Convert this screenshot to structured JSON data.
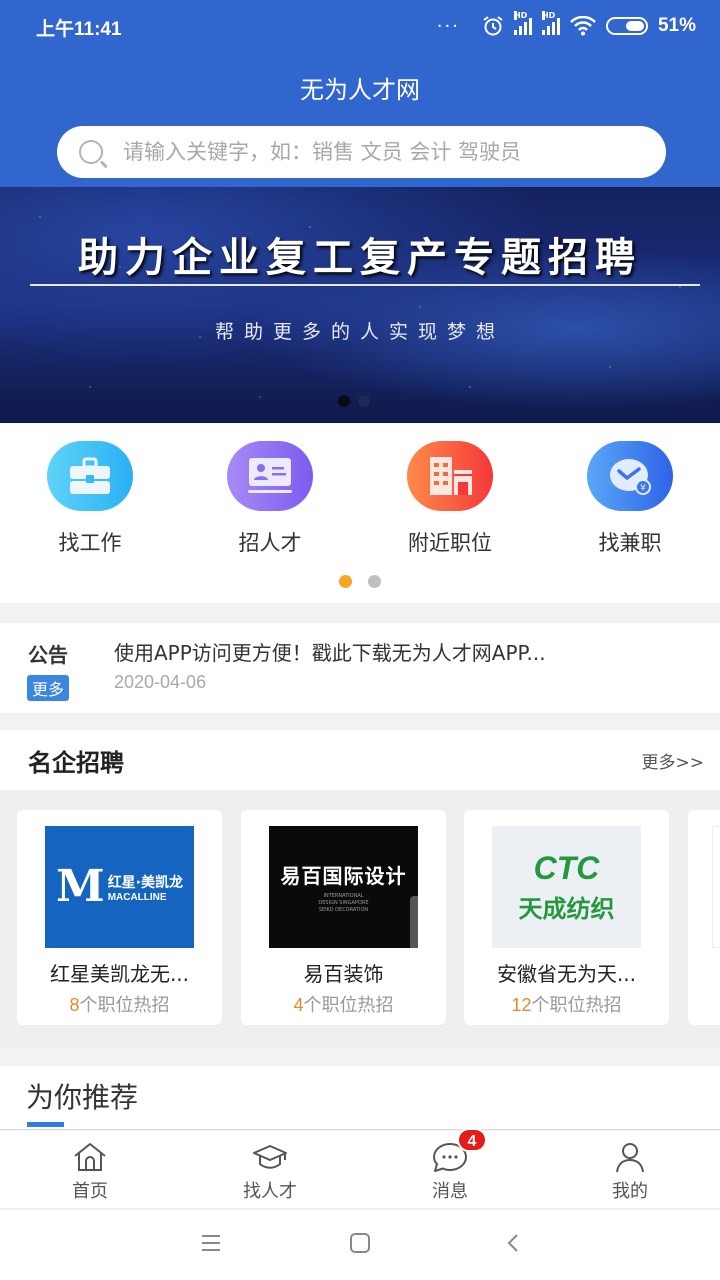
{
  "status_bar": {
    "time": "上午11:41",
    "dots": "···",
    "battery_percent": "51%",
    "battery_level": 0.51,
    "icons": [
      "alarm-icon",
      "signal-hd-icon",
      "signal-hd-icon",
      "wifi-icon",
      "battery-icon"
    ]
  },
  "header": {
    "title": "无为人才网",
    "search_placeholder": "请输入关键字，如：销售 文员 会计 驾驶员"
  },
  "banner": {
    "title": "助力企业复工复产专题招聘",
    "subtitle": "帮助更多的人实现梦想",
    "slides": 2,
    "active_slide": 1
  },
  "quick_nav": {
    "items": [
      {
        "label": "找工作",
        "icon": "briefcase-icon",
        "color_from": "#5dd3f7",
        "color_to": "#2bb0f5"
      },
      {
        "label": "招人才",
        "icon": "id-card-icon",
        "color_from": "#a68bf5",
        "color_to": "#7c5cf0"
      },
      {
        "label": "附近职位",
        "icon": "building-icon",
        "color_from": "#ff8a4c",
        "color_to": "#f5383a"
      },
      {
        "label": "找兼职",
        "icon": "clock-money-icon",
        "color_from": "#5aa8f7",
        "color_to": "#2e63e8"
      }
    ],
    "pages": 2,
    "active_page": 1
  },
  "notice": {
    "label": "公告",
    "more": "更多",
    "text": "使用APP访问更方便！戳此下载无为人才网APP...",
    "date": "2020-04-06"
  },
  "famous": {
    "title": "名企招聘",
    "more": "更多>>",
    "companies": [
      {
        "name": "红星美凯龙无...",
        "jobs_count": "8",
        "jobs_suffix": "个职位热招",
        "logo_cn": "红星·美凯龙",
        "logo_mark": "M",
        "logo_en": "MACALLINE"
      },
      {
        "name": "易百装饰",
        "jobs_count": "4",
        "jobs_suffix": "个职位热招",
        "logo_cn": "易百国际设计",
        "logo_en": "INTERNATIONAL DESIGN SINGAPORE SEIKO DECORATION"
      },
      {
        "name": "安徽省无为天...",
        "jobs_count": "12",
        "jobs_suffix": "个职位热招",
        "logo_mark": "CTC",
        "logo_cn": "天成纺织"
      }
    ]
  },
  "recommend": {
    "title": "为你推荐"
  },
  "tabbar": {
    "items": [
      {
        "label": "首页",
        "icon": "home-icon"
      },
      {
        "label": "找人才",
        "icon": "graduation-cap-icon"
      },
      {
        "label": "消息",
        "icon": "chat-bubble-icon",
        "badge": "4"
      },
      {
        "label": "我的",
        "icon": "user-icon"
      }
    ]
  },
  "colors": {
    "brand": "#3166cf",
    "accent_blue": "#3a86e0",
    "highlight_orange": "#e58a2b",
    "badge_red": "#e81b1b",
    "dot_active": "#f5a623"
  }
}
